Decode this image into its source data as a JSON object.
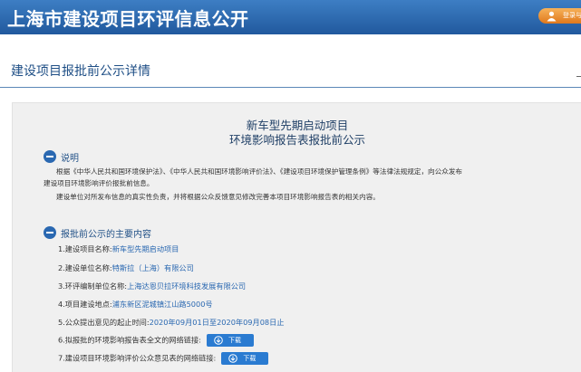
{
  "header": {
    "site_title": "上海市建设项目环评信息公开",
    "login_label": "登录与"
  },
  "page": {
    "heading": "建设项目报批前公示详情"
  },
  "document": {
    "title_line1": "新车型先期启动项目",
    "title_line2": "环境影响报告表报批前公示",
    "section1": {
      "label": "说明",
      "para1_line1": "根据《中华人民共和国环境保护法》、《中华人民共和国环境影响评价法》、《建设项目环境保护管理条例》等法律法规规定，向公众发布",
      "para1_line2": "建设项目环境影响评价报批前信息。",
      "para2": "建设单位对所发布信息的真实性负责，并将根据公众反馈意见修改完善本项目环境影响报告表的相关内容。"
    },
    "section2": {
      "label": "报批前公示的主要内容",
      "items": [
        {
          "key": "1.建设项目名称:",
          "value": "新车型先期启动项目"
        },
        {
          "key": "2.建设单位名称:",
          "value": "特斯拉（上海）有限公司"
        },
        {
          "key": "3.环评编制单位名称:",
          "value": "上海达恩贝拉环境科技发展有限公司"
        },
        {
          "key": "4.项目建设地点:",
          "value": "浦东新区泥城镇江山路5000号"
        },
        {
          "key": "5.公众提出意见的起止时间:",
          "value": "2020年09月01日至2020年09月08日止"
        },
        {
          "key": "6.拟报批的环境影响报告表全文的网络链接:",
          "button": "下载"
        },
        {
          "key": "7.建设项目环境影响评价公众意见表的网络链接:",
          "button": "下载"
        }
      ]
    }
  },
  "colors": {
    "header_blue": "#21599e",
    "accent_blue": "#2a68b1",
    "panel_bg": "#f0f0f0",
    "login_orange": "#e0781c"
  },
  "icons": {
    "login": "user-icon",
    "section_badge": "minus-circle-icon",
    "download": "download-arrow-icon"
  }
}
